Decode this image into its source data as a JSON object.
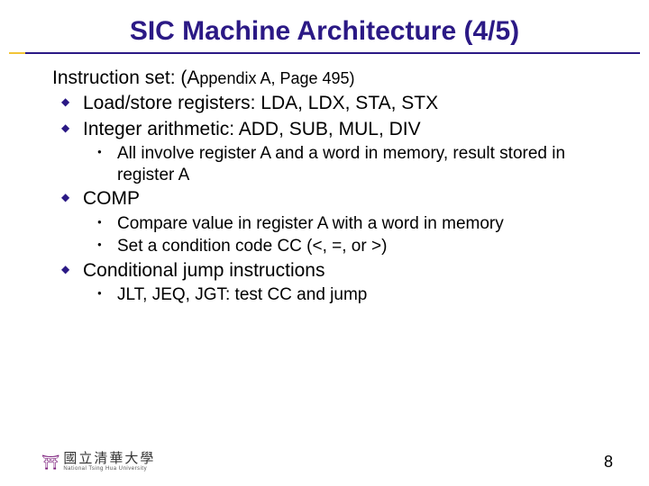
{
  "title": "SIC Machine Architecture (4/5)",
  "lead_a": "Instruction set: (A",
  "lead_b": "ppendix A, Page 495)",
  "items": {
    "loadstore": "Load/store registers: LDA, LDX, STA, STX",
    "intarith": "Integer arithmetic: ADD, SUB, MUL, DIV",
    "intarith_sub": "All involve register A and a word in memory, result stored in register A",
    "comp": "COMP",
    "comp_sub1": "Compare value in register A with a word in memory",
    "comp_sub2": "Set a condition code CC (<, =, or >)",
    "condjump": "Conditional jump instructions",
    "condjump_sub": "JLT, JEQ, JGT: test CC and jump"
  },
  "footer": {
    "logo_cn": "國立清華大學",
    "logo_en": "National Tsing Hua University",
    "page": "8"
  }
}
